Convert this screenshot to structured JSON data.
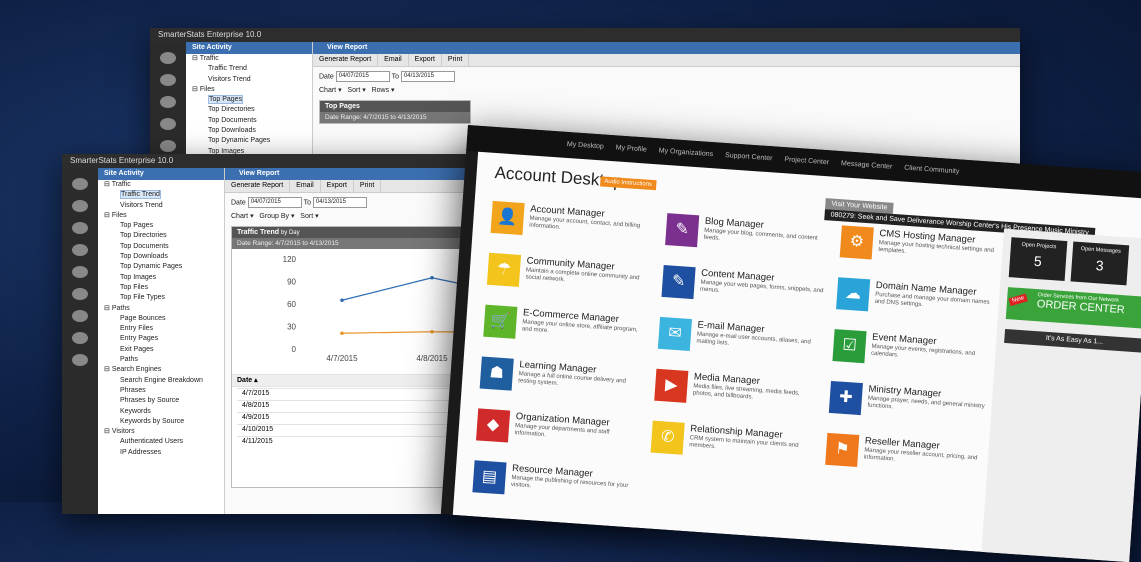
{
  "app_title": "SmarterStats Enterprise 10.0",
  "sidebar_header": "Site Activity",
  "back_win": {
    "items": [
      {
        "t": "Traffic",
        "l": 1
      },
      {
        "t": "Traffic Trend",
        "l": 2
      },
      {
        "t": "Visitors Trend",
        "l": 2
      },
      {
        "t": "Files",
        "l": 1
      },
      {
        "t": "Top Pages",
        "l": 2,
        "sel": true
      },
      {
        "t": "Top Directories",
        "l": 2
      },
      {
        "t": "Top Documents",
        "l": 2
      },
      {
        "t": "Top Downloads",
        "l": 2
      },
      {
        "t": "Top Dynamic Pages",
        "l": 2
      },
      {
        "t": "Top Images",
        "l": 2
      }
    ],
    "panel_title": "Top Pages",
    "date_range": "Date Range: 4/7/2015 to 4/13/2015"
  },
  "front_win": {
    "items": [
      {
        "t": "Traffic",
        "l": 1
      },
      {
        "t": "Traffic Trend",
        "l": 2,
        "sel": true
      },
      {
        "t": "Visitors Trend",
        "l": 2
      },
      {
        "t": "Files",
        "l": 1
      },
      {
        "t": "Top Pages",
        "l": 2
      },
      {
        "t": "Top Directories",
        "l": 2
      },
      {
        "t": "Top Documents",
        "l": 2
      },
      {
        "t": "Top Downloads",
        "l": 2
      },
      {
        "t": "Top Dynamic Pages",
        "l": 2
      },
      {
        "t": "Top Images",
        "l": 2
      },
      {
        "t": "Top Files",
        "l": 2
      },
      {
        "t": "Top File Types",
        "l": 2
      },
      {
        "t": "Paths",
        "l": 1
      },
      {
        "t": "Page Bounces",
        "l": 2
      },
      {
        "t": "Entry Files",
        "l": 2
      },
      {
        "t": "Entry Pages",
        "l": 2
      },
      {
        "t": "Exit Pages",
        "l": 2
      },
      {
        "t": "Paths",
        "l": 2
      },
      {
        "t": "Search Engines",
        "l": 1
      },
      {
        "t": "Search Engine Breakdown",
        "l": 2
      },
      {
        "t": "Phrases",
        "l": 2
      },
      {
        "t": "Phrases by Source",
        "l": 2
      },
      {
        "t": "Keywords",
        "l": 2
      },
      {
        "t": "Keywords by Source",
        "l": 2
      },
      {
        "t": "Visitors",
        "l": 1
      },
      {
        "t": "Authenticated Users",
        "l": 2
      },
      {
        "t": "IP Addresses",
        "l": 2
      }
    ],
    "panel_title": "Traffic Trend",
    "panel_title_suffix": "by Day",
    "date_range": "Date Range: 4/7/2015 to 4/13/2015",
    "table_header": "Date",
    "table_rows": [
      "4/7/2015",
      "4/8/2015",
      "4/9/2015",
      "4/10/2015",
      "4/11/2015"
    ]
  },
  "view_report": "View Report",
  "buttons": [
    "Generate Report",
    "Email",
    "Export",
    "Print"
  ],
  "date_label": "Date",
  "date_from": "04/07/2015",
  "to_label": "To",
  "date_to": "04/13/2015",
  "back_menus": [
    "Chart",
    "Sort",
    "Rows"
  ],
  "front_menus": [
    "Chart",
    "Group By",
    "Sort"
  ],
  "chart_data": {
    "type": "line",
    "x": [
      "4/7/2015",
      "4/8/2015",
      "4/9/2015"
    ],
    "yticks": [
      0,
      30,
      60,
      90,
      120
    ],
    "ylim": [
      0,
      120
    ],
    "series": [
      {
        "values": [
          65,
          95,
          70
        ],
        "color": "#2f6db5"
      },
      {
        "values": [
          21,
          23,
          22
        ],
        "color": "#e8962a"
      }
    ]
  },
  "desktop": {
    "nav": [
      "My Desktop",
      "My Profile",
      "My Organizations",
      "Support Center",
      "Project Center",
      "Message Center",
      "Client Community"
    ],
    "title": "Account Desktop",
    "pill": "Audio Instructions",
    "visit": "Visit Your Website",
    "site_name": "080279: Seek and Save Deliverance Worship Center's His Presence Music Ministry",
    "managers": [
      {
        "n": "Account Manager",
        "d": "Manage your account, contact, and billing information.",
        "c": "#f2a51c",
        "i": "👤"
      },
      {
        "n": "Blog Manager",
        "d": "Manage your blog, comments, and content feeds.",
        "c": "#7b2f8f",
        "i": "✎"
      },
      {
        "n": "CMS Hosting Manager",
        "d": "Manage your hosting technical settings and templates.",
        "c": "#f08a1c",
        "i": "⚙"
      },
      {
        "n": "Community Manager",
        "d": "Maintain a complete online community and social network.",
        "c": "#f2c41c",
        "i": "☂"
      },
      {
        "n": "Content Manager",
        "d": "Manage your web pages, forms, snippets, and menus.",
        "c": "#1f4fa0",
        "i": "✎"
      },
      {
        "n": "Domain Name Manager",
        "d": "Purchase and manage your domain names and DNS settings.",
        "c": "#2aa3d8",
        "i": "☁"
      },
      {
        "n": "E-Commerce Manager",
        "d": "Manage your online store, affiliate program, and more.",
        "c": "#5fb52a",
        "i": "🛒"
      },
      {
        "n": "E-mail Manager",
        "d": "Manage e-mail user accounts, aliases, and mailing lists.",
        "c": "#3bb4e0",
        "i": "✉"
      },
      {
        "n": "Event Manager",
        "d": "Manage your events, registrations, and calendars.",
        "c": "#2a9c3a",
        "i": "☑"
      },
      {
        "n": "Learning Manager",
        "d": "Manage a full online course delivery and testing system.",
        "c": "#1f5fa0",
        "i": "☗"
      },
      {
        "n": "Media Manager",
        "d": "Media files, live streaming, media feeds, photos, and billboards.",
        "c": "#d9361f",
        "i": "▶"
      },
      {
        "n": "Ministry Manager",
        "d": "Manage prayer, needs, and general ministry functions.",
        "c": "#1f4fa0",
        "i": "✚"
      },
      {
        "n": "Organization Manager",
        "d": "Manage your departments and staff information.",
        "c": "#d02a2a",
        "i": "◆"
      },
      {
        "n": "Relationship Manager",
        "d": "CRM system to maintain your clients and members.",
        "c": "#f2c41c",
        "i": "✆"
      },
      {
        "n": "Reseller Manager",
        "d": "Manage your reseller account, pricing, and information.",
        "c": "#f0781c",
        "i": "⚑"
      },
      {
        "n": "Resource Manager",
        "d": "Manage the publishing of resources for your visitors.",
        "c": "#1f4fa0",
        "i": "▤"
      }
    ],
    "open_projects_label": "Open Projects",
    "open_projects": "5",
    "open_messages_label": "Open Messages",
    "open_messages": "3",
    "order_small": "Order Services from Our Network",
    "order_big": "ORDER CENTER",
    "new_tag": "New",
    "easy": "It's As Easy As 1..."
  }
}
